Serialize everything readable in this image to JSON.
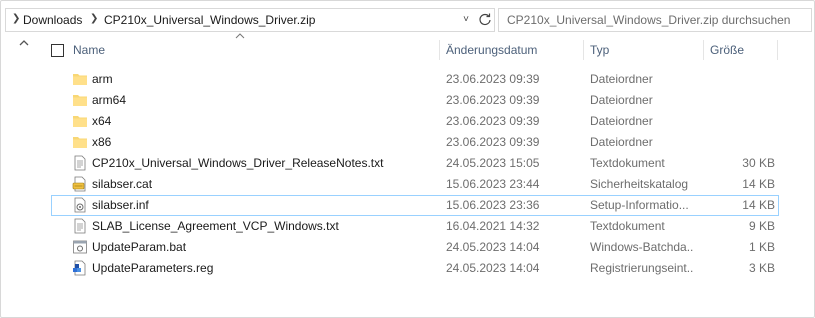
{
  "address": {
    "path": [
      "Downloads",
      "CP210x_Universal_Windows_Driver.zip"
    ]
  },
  "search": {
    "placeholder": "CP210x_Universal_Windows_Driver.zip durchsuchen"
  },
  "columns": {
    "name": "Name",
    "date": "Änderungsdatum",
    "type": "Typ",
    "size": "Größe"
  },
  "files": [
    {
      "name": "arm",
      "date": "23.06.2023 09:39",
      "type": "Dateiordner",
      "size": "",
      "icon": "folder-icon"
    },
    {
      "name": "arm64",
      "date": "23.06.2023 09:39",
      "type": "Dateiordner",
      "size": "",
      "icon": "folder-icon"
    },
    {
      "name": "x64",
      "date": "23.06.2023 09:39",
      "type": "Dateiordner",
      "size": "",
      "icon": "folder-icon"
    },
    {
      "name": "x86",
      "date": "23.06.2023 09:39",
      "type": "Dateiordner",
      "size": "",
      "icon": "folder-icon"
    },
    {
      "name": "CP210x_Universal_Windows_Driver_ReleaseNotes.txt",
      "date": "24.05.2023 15:05",
      "type": "Textdokument",
      "size": "30 KB",
      "icon": "text-file-icon"
    },
    {
      "name": "silabser.cat",
      "date": "15.06.2023 23:44",
      "type": "Sicherheitskatalog",
      "size": "14 KB",
      "icon": "security-catalog-icon"
    },
    {
      "name": "silabser.inf",
      "date": "15.06.2023 23:36",
      "type": "Setup-Informatio...",
      "size": "14 KB",
      "icon": "setup-info-file-icon"
    },
    {
      "name": "SLAB_License_Agreement_VCP_Windows.txt",
      "date": "16.04.2021 14:32",
      "type": "Textdokument",
      "size": "9 KB",
      "icon": "text-file-icon"
    },
    {
      "name": "UpdateParam.bat",
      "date": "24.05.2023 14:04",
      "type": "Windows-Batchda...",
      "size": "1 KB",
      "icon": "batch-file-icon"
    },
    {
      "name": "UpdateParameters.reg",
      "date": "24.05.2023 14:04",
      "type": "Registrierungseint...",
      "size": "3 KB",
      "icon": "registry-file-icon"
    }
  ]
}
